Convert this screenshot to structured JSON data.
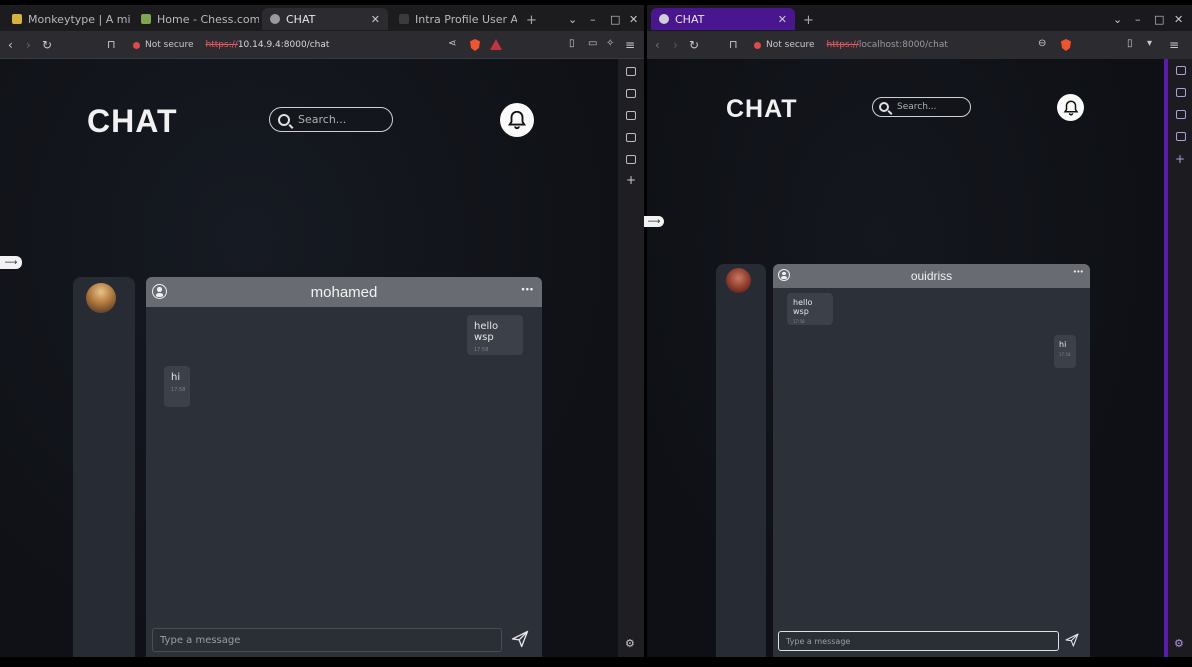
{
  "left_browser": {
    "tabs": [
      {
        "label": "Monkeytype | A minima",
        "active": false
      },
      {
        "label": "Home - Chess.com",
        "active": false
      },
      {
        "label": "CHAT",
        "active": true
      },
      {
        "label": "Intra Profile User Applic",
        "active": false
      }
    ],
    "new_tab": "+",
    "url_warning": "Not secure",
    "url_protocol": "https://",
    "url_rest": "10.14.9.4:8000/chat"
  },
  "right_browser": {
    "tabs": [
      {
        "label": "CHAT",
        "active": true
      }
    ],
    "new_tab": "+",
    "url_warning": "Not secure",
    "url_protocol": "https://",
    "url_rest": "localhost:8000/chat"
  },
  "chat_left": {
    "title": "CHAT",
    "search_placeholder": "Search...",
    "contact_name": "mohamed",
    "more": "•••",
    "messages": [
      {
        "text": "hello wsp",
        "time": "17:58",
        "side": "right"
      },
      {
        "text": "hi",
        "time": "17:58",
        "side": "left"
      }
    ],
    "input_placeholder": "Type a message"
  },
  "chat_right": {
    "title": "CHAT",
    "search_placeholder": "Search...",
    "contact_name": "ouidriss",
    "more": "•••",
    "messages": [
      {
        "text": "hello wsp",
        "time": "17:58",
        "side": "left"
      },
      {
        "text": "hi",
        "time": "17:58",
        "side": "right"
      }
    ],
    "input_placeholder": "Type a message"
  },
  "colors": {
    "accent_right_browser": "#5b1ab0",
    "brave_logo": "#f0542d",
    "not_secure": "#e04a4a"
  }
}
